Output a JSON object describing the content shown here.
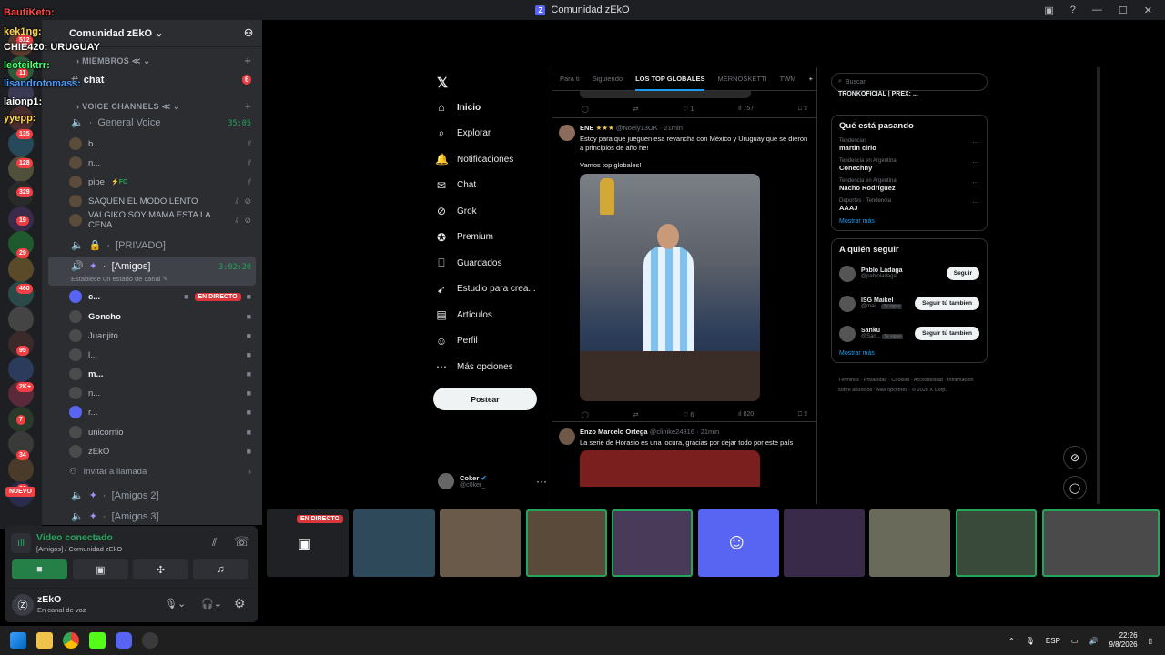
{
  "window": {
    "title": "Comunidad zEkO"
  },
  "chat_overlay": [
    {
      "user": "BautiKeto:",
      "color": "#ff4a4a"
    },
    {
      "user": "kek1ng:",
      "color": "#ffd84a"
    },
    {
      "user": "CHIE420: URUGUAY",
      "color": "#ffffff"
    },
    {
      "user": "leoteiktrr:",
      "color": "#4aff6a"
    },
    {
      "user": "lisandrotomass:",
      "color": "#4a9cff"
    },
    {
      "user": "laionp1:",
      "color": "#ffffff"
    },
    {
      "user": "yyepp:",
      "color": "#ffd84a"
    }
  ],
  "guild_badges": [
    "512",
    "11",
    "135",
    "128",
    "329",
    "19",
    "29",
    "460",
    "95",
    "2K+",
    "7",
    "34",
    "30"
  ],
  "new_badge": "NUEVO",
  "server": {
    "name": "Comunidad zEkO"
  },
  "categories": {
    "members": "MIEMBROS",
    "voice": "VOICE CHANNELS"
  },
  "text_channels": [
    {
      "name": "chat",
      "badge": "6"
    }
  ],
  "general_voice": {
    "name": "General Voice",
    "timer": "35:05",
    "users": [
      {
        "name": "b..."
      },
      {
        "name": "n..."
      },
      {
        "name": "pipe",
        "tag": "FC"
      },
      {
        "name": "SAQUEN EL MODO LENTO"
      },
      {
        "name": "VALGIKO SOY MAMA ESTA LA CENA"
      }
    ]
  },
  "private_channel": {
    "name": "[PRIVADO]"
  },
  "amigos": {
    "name": "[Amigos]",
    "timer": "3:02:20",
    "status": "Establece un estado de canal",
    "users": [
      {
        "name": "c...",
        "live": "EN DIRECTO"
      },
      {
        "name": "Goncho"
      },
      {
        "name": "Juanjito"
      },
      {
        "name": "l..."
      },
      {
        "name": "m..."
      },
      {
        "name": "n..."
      },
      {
        "name": "r..."
      },
      {
        "name": "unicornio"
      },
      {
        "name": "zEkO"
      }
    ]
  },
  "invite_label": "Invitar a llamada",
  "amigos2": "[Amigos 2]",
  "amigos3": "[Amigos 3]",
  "voice_panel": {
    "status": "Video conectado",
    "channel": "[Amigos] / Comunidad zEkO",
    "user": "zEkO",
    "substatus": "En canal de voz"
  },
  "x_nav": [
    {
      "icon": "home-icon",
      "label": "Inicio"
    },
    {
      "icon": "search-icon",
      "label": "Explorar"
    },
    {
      "icon": "bell-icon",
      "label": "Notificaciones"
    },
    {
      "icon": "chat-icon",
      "label": "Chat"
    },
    {
      "icon": "grok-icon",
      "label": "Grok"
    },
    {
      "icon": "premium-icon",
      "label": "Premium"
    },
    {
      "icon": "bookmark-icon",
      "label": "Guardados"
    },
    {
      "icon": "rocket-icon",
      "label": "Estudio para crea..."
    },
    {
      "icon": "article-icon",
      "label": "Artículos"
    },
    {
      "icon": "person-icon",
      "label": "Perfil"
    },
    {
      "icon": "more-icon",
      "label": "Más opciones"
    }
  ],
  "post_button": "Postear",
  "profile": {
    "name": "Coker",
    "handle": "@c0ker_"
  },
  "feed_tabs": [
    "Para ti",
    "Siguiendo",
    "LOS TOP GLOBALES",
    "MERNOSKETTI",
    "TWM"
  ],
  "feed_tabs_selected": "LOS TOP GLOBALES",
  "tweet_top_actions": {
    "likes": "1",
    "views": "757"
  },
  "tweet1": {
    "author": "ENE",
    "handle": "@Noely13OK",
    "time": "21min",
    "text": "Estoy para que jueguen esa revancha con México y Uruguay que se dieron a principios de año he!",
    "text2": "Vamos top globales!",
    "likes": "6",
    "views": "820"
  },
  "tweet2": {
    "author": "Enzo Marcelo Ortega",
    "handle": "@clinike24816",
    "time": "21min",
    "text": "La serie de Horasio es una locura, gracias por dejar todo por este país"
  },
  "search_placeholder": "Buscar",
  "spaces_text": "TRONKOFICIAL | PREX: ...",
  "trending": {
    "title": "Qué está pasando",
    "items": [
      {
        "meta": "Tendencias",
        "name": "martin cirio"
      },
      {
        "meta": "Tendencia en Argentina",
        "name": "Conechny"
      },
      {
        "meta": "Tendencia en Argentina",
        "name": "Nacho Rodríguez"
      },
      {
        "meta": "Deportes · Tendencia",
        "name": "AAAJ"
      }
    ],
    "more": "Mostrar más"
  },
  "who_to_follow": {
    "title": "A quién seguir",
    "items": [
      {
        "name": "Pablo Ladaga",
        "handle": "@pabloladaga",
        "button": "Seguir"
      },
      {
        "name": "ISG Maikel",
        "handle": "@mai...",
        "tag": "Te sigue",
        "button": "Seguir tú también"
      },
      {
        "name": "Sanku",
        "handle": "@San...",
        "tag": "Te sigue",
        "button": "Seguir tú también"
      }
    ],
    "more": "Mostrar más"
  },
  "footer_links": [
    "Términos",
    "Privacidad",
    "Cookies",
    "Accesibilidad",
    "Información sobre anuncios",
    "Más opciones",
    "© 2026 X Corp."
  ],
  "stream_label": "EN DIRECTO",
  "tray": {
    "lang": "ESP",
    "time": "22:26",
    "date": "9/8/2026"
  }
}
